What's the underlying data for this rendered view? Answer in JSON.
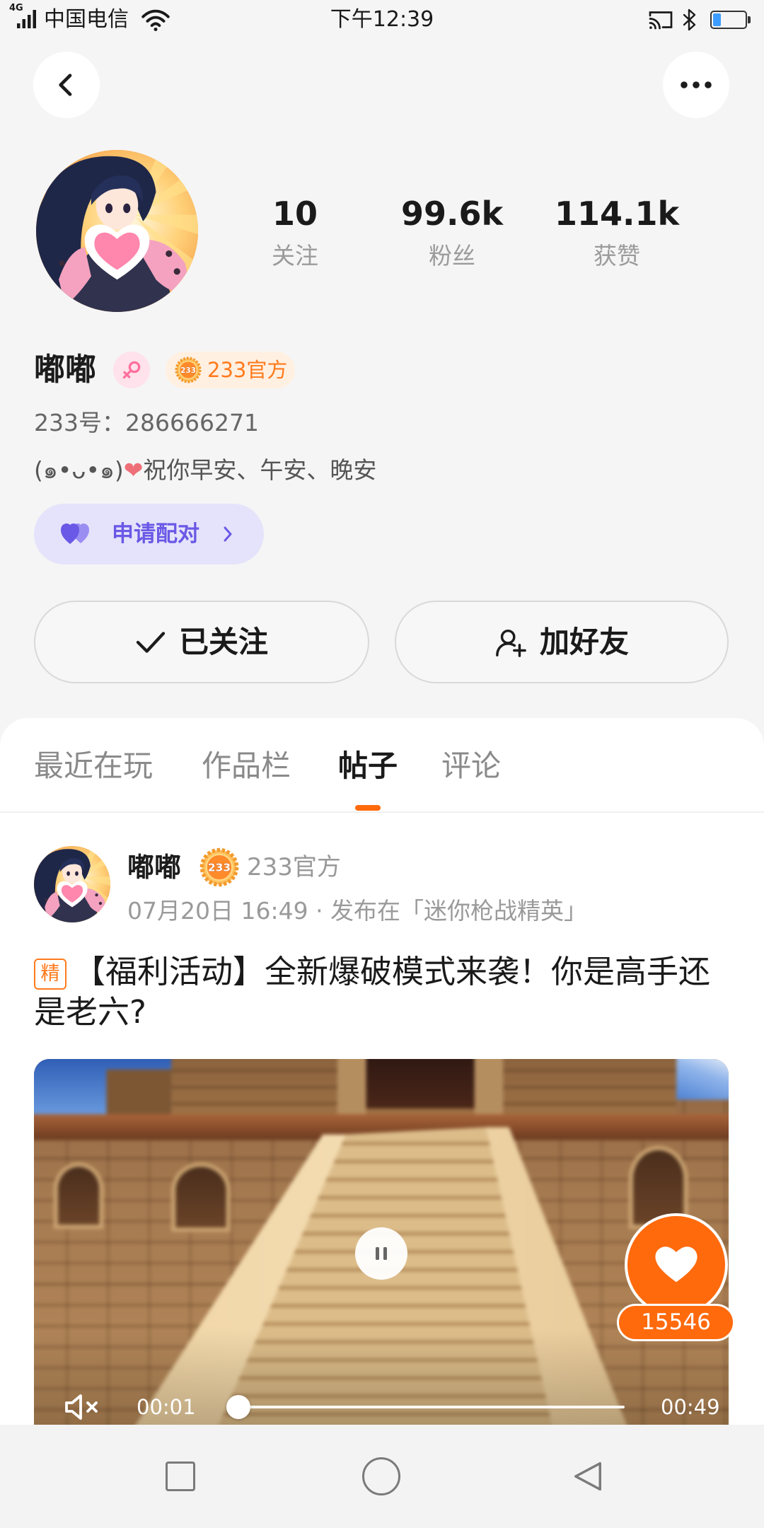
{
  "status_bar": {
    "network": "4G",
    "carrier": "中国电信",
    "time": "下午12:39",
    "battery_level": 0.25,
    "icons": [
      "signal-icon",
      "wifi-icon",
      "cast-icon",
      "bluetooth-icon",
      "battery-icon"
    ]
  },
  "header": {
    "back_icon": "back-arrow-icon",
    "more_icon": "more-dots-icon"
  },
  "profile": {
    "name": "嘟嘟",
    "gender_icon": "female-icon",
    "badge_logo_text": "233",
    "official_badge": "233官方",
    "id_text": "233号：286666271",
    "bio": {
      "face": "(๑•ᴗ•๑)",
      "heart": "❤",
      "text": "祝你早安、午安、晚安"
    },
    "stats": [
      {
        "value": "10",
        "label": "关注"
      },
      {
        "value": "99.6k",
        "label": "粉丝"
      },
      {
        "value": "114.1k",
        "label": "获赞"
      }
    ],
    "pair_button": {
      "label": "申请配对",
      "icon": "double-heart-icon"
    },
    "follow_button": {
      "label": "已关注",
      "icon": "check-icon"
    },
    "add_friend_button": {
      "label": "加好友",
      "icon": "user-plus-icon"
    }
  },
  "tabs": [
    {
      "label": "最近在玩",
      "active": false
    },
    {
      "label": "作品栏",
      "active": false
    },
    {
      "label": "帖子",
      "active": true
    },
    {
      "label": "评论",
      "active": false
    }
  ],
  "post": {
    "author": "嘟嘟",
    "badge_logo_text": "233",
    "badge": "233官方",
    "meta": "07月20日 16:49 · 发布在「迷你枪战精英」",
    "tag": "精",
    "title": "【福利活动】全新爆破模式来袭！你是高手还是老六?",
    "video": {
      "current_time": "00:01",
      "duration": "00:49",
      "progress": 0.02,
      "like_count": "15546",
      "icons": [
        "pause-icon",
        "like-heart-icon",
        "muted-speaker-icon"
      ]
    }
  },
  "nav_bar": {
    "icons": [
      "recent-apps-icon",
      "home-icon",
      "nav-back-icon"
    ]
  },
  "colors": {
    "page_bg": "#f5f5f5",
    "accent_orange": "#ff6a0d",
    "badge_orange": "#ff7a1c",
    "pair_purple": "#6a59e6",
    "pair_bg": "#e5e3fb",
    "female_pink": "#ff6f9c"
  }
}
